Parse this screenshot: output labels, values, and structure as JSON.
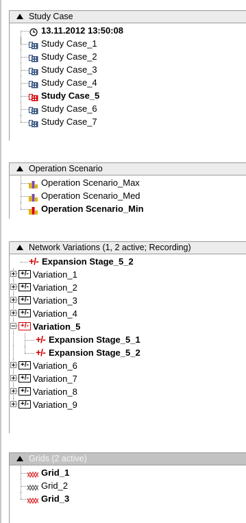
{
  "study_case": {
    "header": "Study Case",
    "items": [
      {
        "label": "13.11.2012 13:50:08",
        "icon": "clock-icon",
        "bold": true
      },
      {
        "label": "Study Case_1",
        "icon": "study-case-icon",
        "bold": false
      },
      {
        "label": "Study Case_2",
        "icon": "study-case-icon",
        "bold": false
      },
      {
        "label": "Study Case_3",
        "icon": "study-case-icon",
        "bold": false
      },
      {
        "label": "Study Case_4",
        "icon": "study-case-icon",
        "bold": false
      },
      {
        "label": "Study Case_5",
        "icon": "study-case-active-icon",
        "bold": true
      },
      {
        "label": "Study Case_6",
        "icon": "study-case-icon",
        "bold": false
      },
      {
        "label": "Study Case_7",
        "icon": "study-case-icon",
        "bold": false
      }
    ]
  },
  "operation_scenario": {
    "header": "Operation Scenario",
    "items": [
      {
        "label": "Operation Scenario_Max",
        "icon": "operation-scenario-icon",
        "bold": false
      },
      {
        "label": "Operation Scenario_Med",
        "icon": "operation-scenario-icon",
        "bold": false
      },
      {
        "label": "Operation Scenario_Min",
        "icon": "operation-scenario-active-icon",
        "bold": true
      }
    ]
  },
  "network_variations": {
    "header": "Network Variations (1, 2 active; Recording)",
    "recording_stage": {
      "label": "Expansion Stage_5_2",
      "icon": "expansion-stage-icon",
      "bold": true
    },
    "variations": [
      {
        "label": "Variation_1",
        "expanded": false,
        "bold": false
      },
      {
        "label": "Variation_2",
        "expanded": false,
        "bold": false
      },
      {
        "label": "Variation_3",
        "expanded": false,
        "bold": false
      },
      {
        "label": "Variation_4",
        "expanded": false,
        "bold": false
      },
      {
        "label": "Variation_5",
        "expanded": true,
        "bold": true,
        "children": [
          {
            "label": "Expansion Stage_5_1",
            "bold": true
          },
          {
            "label": "Expansion Stage_5_2",
            "bold": true
          }
        ]
      },
      {
        "label": "Variation_6",
        "expanded": false,
        "bold": false
      },
      {
        "label": "Variation_7",
        "expanded": false,
        "bold": false
      },
      {
        "label": "Variation_8",
        "expanded": false,
        "bold": false
      },
      {
        "label": "Variation_9",
        "expanded": false,
        "bold": false
      }
    ]
  },
  "grids": {
    "header": "Grids (2 active)",
    "items": [
      {
        "label": "Grid_1",
        "icon": "grid-active-icon",
        "bold": true
      },
      {
        "label": "Grid_2",
        "icon": "grid-icon",
        "bold": false
      },
      {
        "label": "Grid_3",
        "icon": "grid-active-icon",
        "bold": true
      }
    ]
  },
  "icon_symbols": {
    "plus_minus": "+/-",
    "clock": "⌚"
  },
  "colors": {
    "active_red": "#d40000",
    "study_case_icon": "#2a4a7a",
    "grid_red": "#e03030",
    "grid_grey": "#606060"
  }
}
